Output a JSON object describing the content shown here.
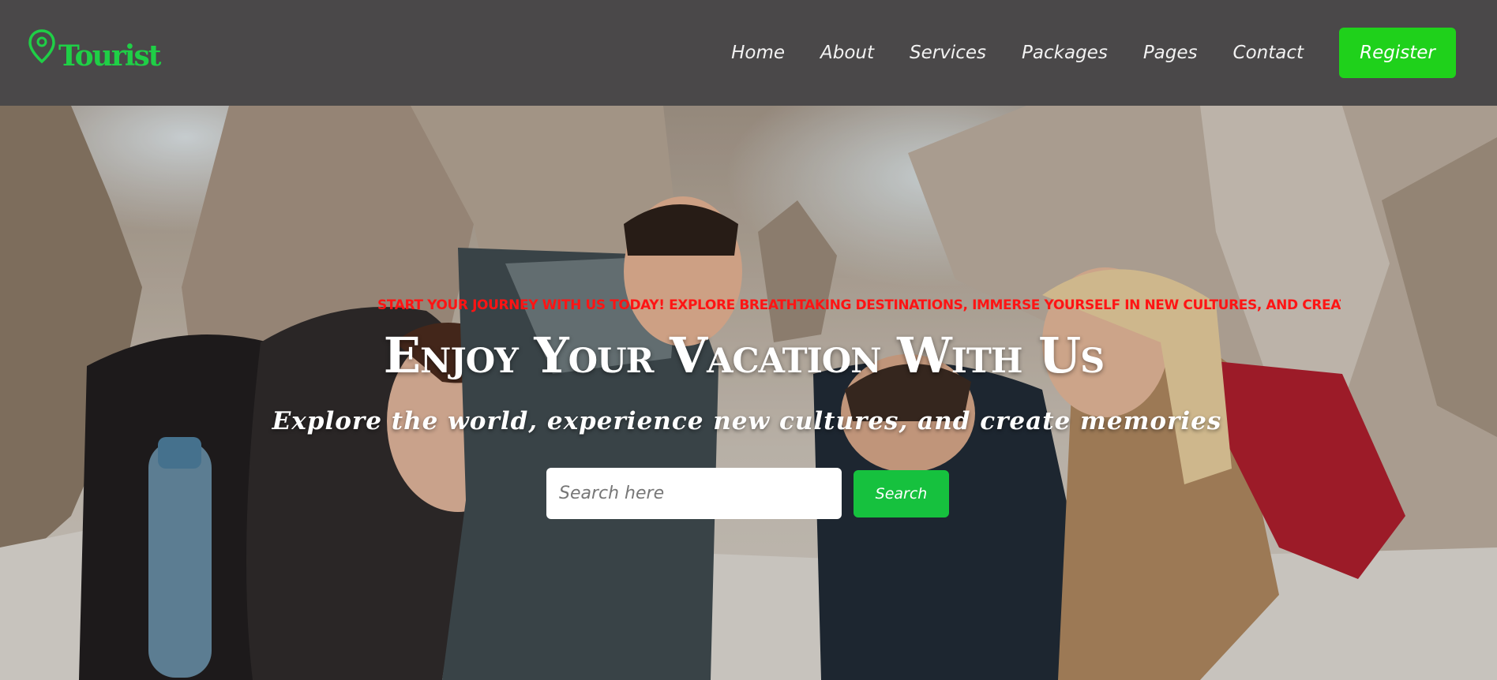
{
  "brand": {
    "name": "Tourist",
    "icon": "map-pin-icon",
    "color": "#1fcf46"
  },
  "nav": {
    "items": [
      "Home",
      "About",
      "Services",
      "Packages",
      "Pages",
      "Contact"
    ],
    "register_label": "Register",
    "register_color": "#1fd11b",
    "background": "#4a4849"
  },
  "hero": {
    "ticker": "Start your journey with us today! Explore breathtaking destinations, immerse yourself in new cultures, and creat",
    "ticker_color": "#ff1414",
    "title": "Enjoy Your Vacation With Us",
    "subtitle": "Explore the world, experience new cultures, and create memories",
    "search": {
      "placeholder": "Search here",
      "value": "",
      "button_label": "Search",
      "button_color": "#16c13e"
    }
  }
}
